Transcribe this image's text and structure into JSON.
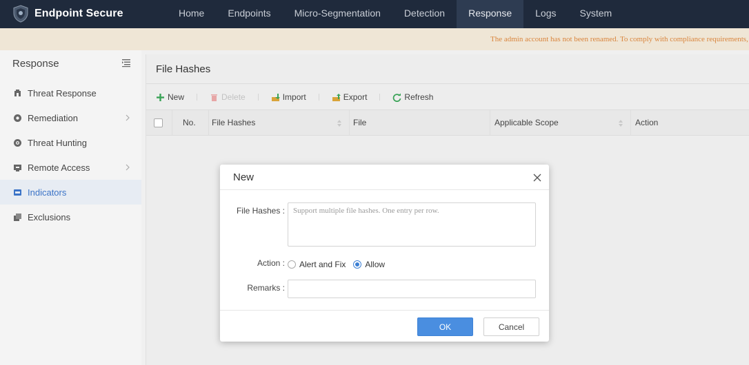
{
  "brand": {
    "name": "Endpoint Secure"
  },
  "nav": {
    "items": [
      "Home",
      "Endpoints",
      "Micro-Segmentation",
      "Detection",
      "Response",
      "Logs",
      "System"
    ],
    "active": "Response"
  },
  "banner": {
    "text": "The admin account has not been renamed. To comply with compliance requirements, p"
  },
  "sidebar": {
    "title": "Response",
    "items": [
      {
        "label": "Threat Response",
        "icon": "threat-response-icon",
        "chevron": false
      },
      {
        "label": "Remediation",
        "icon": "remediation-icon",
        "chevron": true
      },
      {
        "label": "Threat Hunting",
        "icon": "threat-hunting-icon",
        "chevron": false
      },
      {
        "label": "Remote Access",
        "icon": "remote-access-icon",
        "chevron": true
      },
      {
        "label": "Indicators",
        "icon": "indicators-icon",
        "chevron": false,
        "active": true
      },
      {
        "label": "Exclusions",
        "icon": "exclusions-icon",
        "chevron": false
      }
    ]
  },
  "main": {
    "title": "File Hashes",
    "toolbar": {
      "new": "New",
      "delete": "Delete",
      "import": "Import",
      "export": "Export",
      "refresh": "Refresh"
    },
    "columns": {
      "no": "No.",
      "hashes": "File Hashes",
      "file": "File",
      "scope": "Applicable Scope",
      "action": "Action"
    }
  },
  "modal": {
    "title": "New",
    "hashes_label": "File Hashes :",
    "hashes_placeholder": "Support multiple file hashes. One entry per row.",
    "action_label": "Action :",
    "action_options": [
      "Alert and Fix",
      "Allow"
    ],
    "action_selected": "Allow",
    "remarks_label": "Remarks :",
    "remarks_value": "",
    "ok_label": "OK",
    "cancel_label": "Cancel"
  },
  "colors": {
    "topbar": "#1f2a3c",
    "accent": "#4a8ee0",
    "banner_text": "#d9843c",
    "active_menu_text": "#3c74c7"
  }
}
